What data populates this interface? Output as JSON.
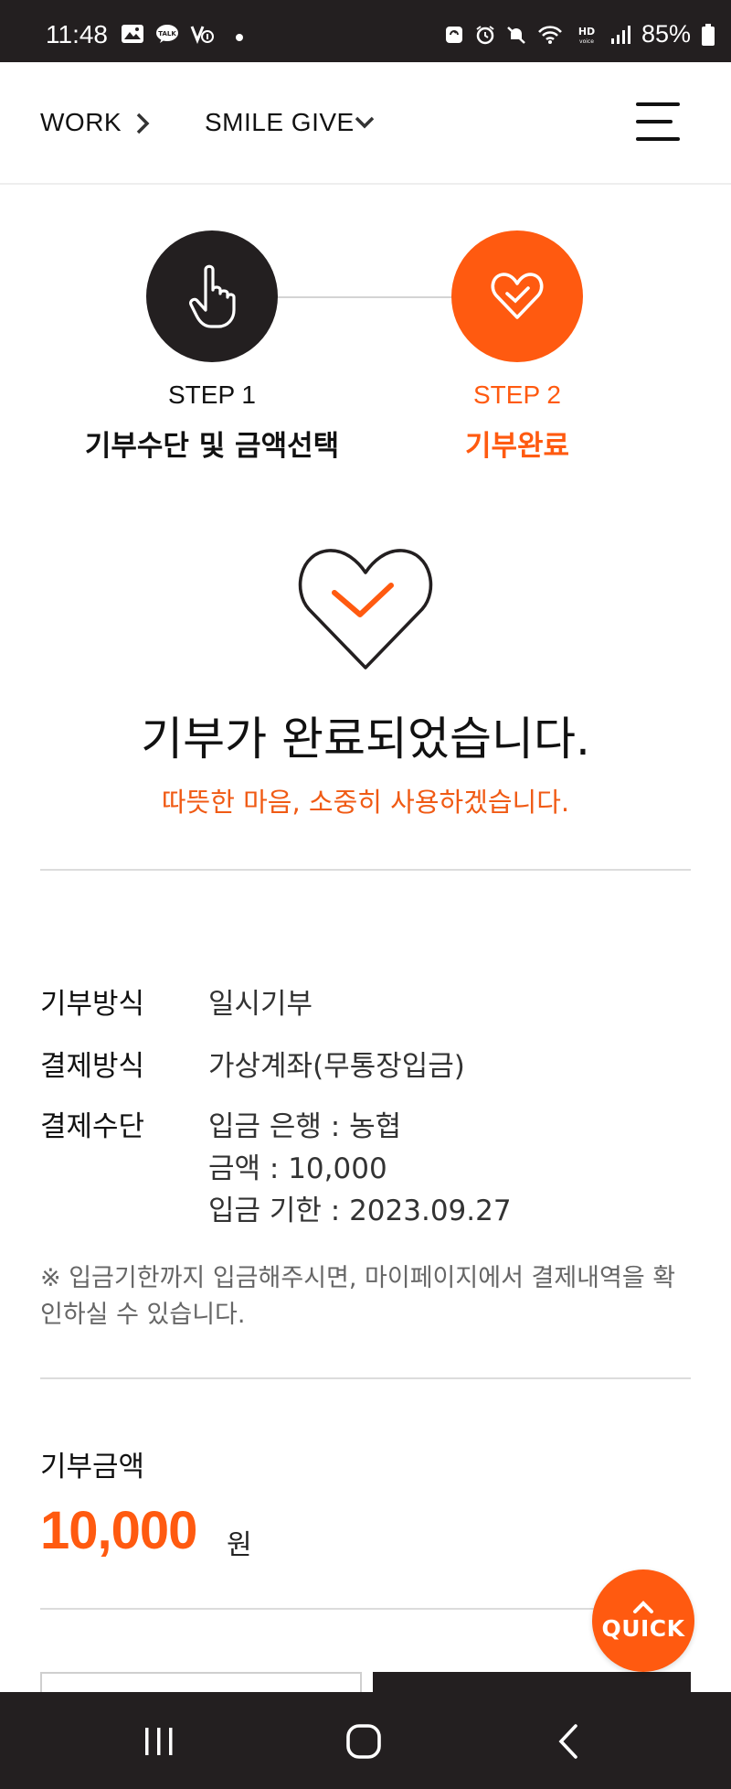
{
  "status_bar": {
    "time": "11:48",
    "battery": "85%",
    "left_icons": [
      "gallery-icon",
      "kakaotalk-icon",
      "notification-icon"
    ],
    "right_icons": [
      "lock-icon",
      "alarm-icon",
      "mute-icon",
      "wifi-icon",
      "hd-voice-icon",
      "signal-icon",
      "battery-icon"
    ]
  },
  "header": {
    "breadcrumb_work": "WORK",
    "breadcrumb_smile": "SMILE GIVE"
  },
  "stepper": {
    "step1_num": "STEP 1",
    "step1_title": "기부수단 및 금액선택",
    "step2_num": "STEP 2",
    "step2_title": "기부완료",
    "active_color": "#ff5a10",
    "inactive_color": "#231f20"
  },
  "completion": {
    "title": "기부가 완료되었습니다.",
    "subtitle": "따뜻한 마음, 소중히 사용하겠습니다."
  },
  "info": {
    "method_label": "기부방식",
    "method_value": "일시기부",
    "payment_label": "결제방식",
    "payment_value": "가상계좌(무통장입금)",
    "means_label": "결제수단",
    "bank_line": "입금 은행 : 농협",
    "amount_line": "금액 : 10,000",
    "deadline_line": "입금 기한 : 2023.09.27",
    "notice": "※ 입금기한까지 입금해주시면, 마이페이지에서 결제내역을 확인하실 수 있습니다."
  },
  "donation": {
    "label": "기부금액",
    "amount": "10,000",
    "unit": "원"
  },
  "quick": {
    "label": "QUICK"
  },
  "colors": {
    "accent": "#ff5a10",
    "dark": "#231f20"
  }
}
